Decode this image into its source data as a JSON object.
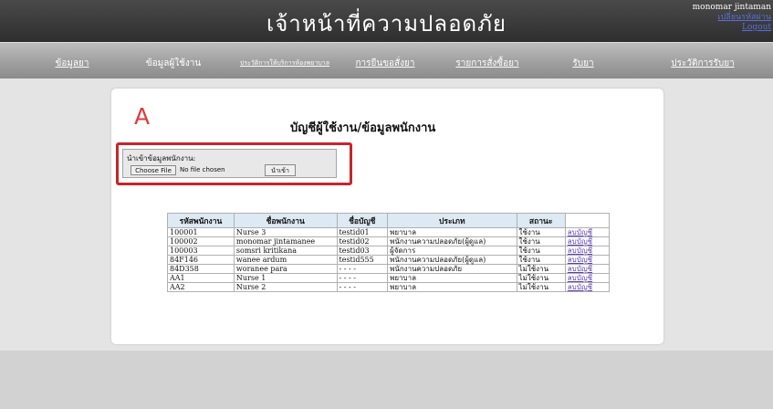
{
  "header": {
    "title": "เจ้าหน้าที่ความปลอดภัย",
    "user_name": "monomar jintaman",
    "link_change_password": "เปลี่ยนรหัสผ่าน",
    "link_logout": "Logout"
  },
  "nav": {
    "items": [
      {
        "label": "ข้อมูลยา"
      },
      {
        "label": "ข้อมูลผู้ใช้งาน"
      },
      {
        "label": "ประวัติการให้บริการห้องพยาบาล"
      },
      {
        "label": "การยืนขอสั่งยา"
      },
      {
        "label": "รายการสั่งซื้อยา"
      },
      {
        "label": "รับยา"
      },
      {
        "label": "ประวัติการรับยา"
      }
    ]
  },
  "page": {
    "annotation_letter": "A",
    "heading": "บัญชีผู้ใช้งาน/ข้อมูลพนักงาน"
  },
  "import": {
    "label": "นำเข้าข้อมูลพนักงาน:",
    "choose_file": "Choose File",
    "file_status": "No file chosen",
    "submit": "นำเข้า"
  },
  "table": {
    "headers": [
      "รหัสพนักงาน",
      "ชื่อพนักงาน",
      "ชื่อบัญชี",
      "ประเภท",
      "สถานะ",
      ""
    ],
    "rows": [
      {
        "id": "100001",
        "name": "Nurse 3",
        "account": "testid01",
        "type": "พยาบาล",
        "status": "ใช้งาน",
        "action": "ลบบัญชี"
      },
      {
        "id": "100002",
        "name": "monomar jintamanee",
        "account": "testid02",
        "type": "พนักงานความปลอดภัย(ผู้ดูแล)",
        "status": "ใช้งาน",
        "action": "ลบบัญชี"
      },
      {
        "id": "100003",
        "name": "somsri kritikana",
        "account": "testid03",
        "type": "ผู้จัดการ",
        "status": "ใช้งาน",
        "action": "ลบบัญชี"
      },
      {
        "id": "84F146",
        "name": "wanee ardum",
        "account": "testid555",
        "type": "พนักงานความปลอดภัย(ผู้ดูแล)",
        "status": "ใช้งาน",
        "action": "ลบบัญชี"
      },
      {
        "id": "84D358",
        "name": "woranee para",
        "account": "- - - -",
        "type": "พนักงานความปลอดภัย",
        "status": "ไม่ใช้งาน",
        "action": "ลบบัญชี"
      },
      {
        "id": "AA1",
        "name": "Nurse 1",
        "account": "- - - -",
        "type": "พยาบาล",
        "status": "ไม่ใช้งาน",
        "action": "ลบบัญชี"
      },
      {
        "id": "AA2",
        "name": "Nurse 2",
        "account": "- - - -",
        "type": "พยาบาล",
        "status": "ไม่ใช้งาน",
        "action": "ลบบัญชี"
      }
    ]
  },
  "colors": {
    "annotation_red": "#c8242b",
    "link": "#5a3fb0",
    "table_header_bg": "#dde9f3"
  }
}
